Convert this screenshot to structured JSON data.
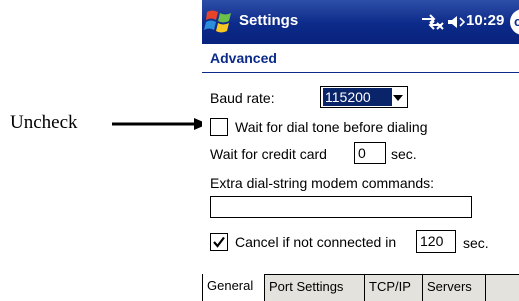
{
  "annotation": {
    "text": "Uncheck"
  },
  "titlebar": {
    "title": "Settings",
    "time": "10:29",
    "ok_label": "ok"
  },
  "subheader": {
    "title": "Advanced"
  },
  "form": {
    "baud_rate_label": "Baud rate:",
    "baud_rate_value": "115200",
    "wait_dial_tone_label": "Wait for dial tone before dialing",
    "wait_dial_tone_checked": false,
    "wait_credit_card_label": "Wait for credit card",
    "wait_credit_card_value": "0",
    "wait_credit_card_unit": "sec.",
    "extra_commands_label": "Extra dial-string modem commands:",
    "extra_commands_value": "",
    "cancel_label": "Cancel if not connected in",
    "cancel_checked": true,
    "cancel_value": "120",
    "cancel_unit": "sec."
  },
  "tabs": [
    {
      "label": "General",
      "active": true
    },
    {
      "label": "Port Settings",
      "active": false
    },
    {
      "label": "TCP/IP",
      "active": false
    },
    {
      "label": "Servers",
      "active": false
    }
  ],
  "colors": {
    "titlebar": "#0c2a89",
    "selection": "#0a246a",
    "tabbar": "#e4e2dc"
  }
}
